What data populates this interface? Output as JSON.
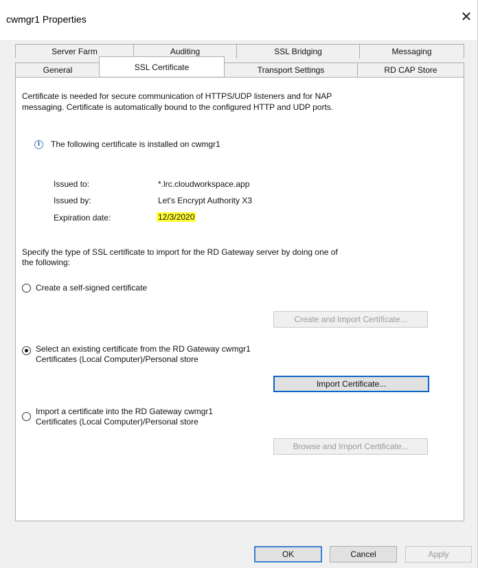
{
  "window": {
    "title": "cwmgr1 Properties",
    "close_glyph": "✕"
  },
  "tabs": {
    "row1": [
      {
        "label": "Server Farm"
      },
      {
        "label": "Auditing"
      },
      {
        "label": "SSL Bridging"
      },
      {
        "label": "Messaging"
      }
    ],
    "row2": [
      {
        "label": "General"
      },
      {
        "label": "SSL Certificate",
        "active": true
      },
      {
        "label": "Transport Settings"
      },
      {
        "label": "RD CAP Store"
      }
    ]
  },
  "panel": {
    "intro_line1": "Certificate is needed for secure communication of HTTPS/UDP listeners and for NAP",
    "intro_line2": "messaging. Certificate is automatically bound to the configured HTTP and UDP ports.",
    "info_icon": "info-icon",
    "installed_text": "The following certificate is installed on cwmgr1",
    "cert": {
      "issued_to_label": "Issued to:",
      "issued_to_value": "*.lrc.cloudworkspace.app",
      "issued_by_label": "Issued by:",
      "issued_by_value": "Let's Encrypt Authority X3",
      "expiration_label": "Expiration date:",
      "expiration_value": "12/3/2020",
      "expiration_highlight": "#ffff33"
    },
    "specify_line1": "Specify the type of SSL certificate to import for the RD Gateway server by doing one of",
    "specify_line2": "the following:",
    "options": {
      "self_signed": {
        "label": "Create a self-signed certificate",
        "checked": false,
        "button": "Create and Import Certificate..."
      },
      "existing": {
        "label_line1": "Select an existing certificate from the RD Gateway cwmgr1",
        "label_line2": "Certificates (Local Computer)/Personal store",
        "checked": true,
        "button": "Import Certificate..."
      },
      "import": {
        "label_line1": "Import a certificate into the RD Gateway cwmgr1",
        "label_line2": "Certificates (Local Computer)/Personal store",
        "checked": false,
        "button": "Browse and Import Certificate..."
      }
    }
  },
  "footer": {
    "ok": "OK",
    "cancel": "Cancel",
    "apply": "Apply"
  }
}
